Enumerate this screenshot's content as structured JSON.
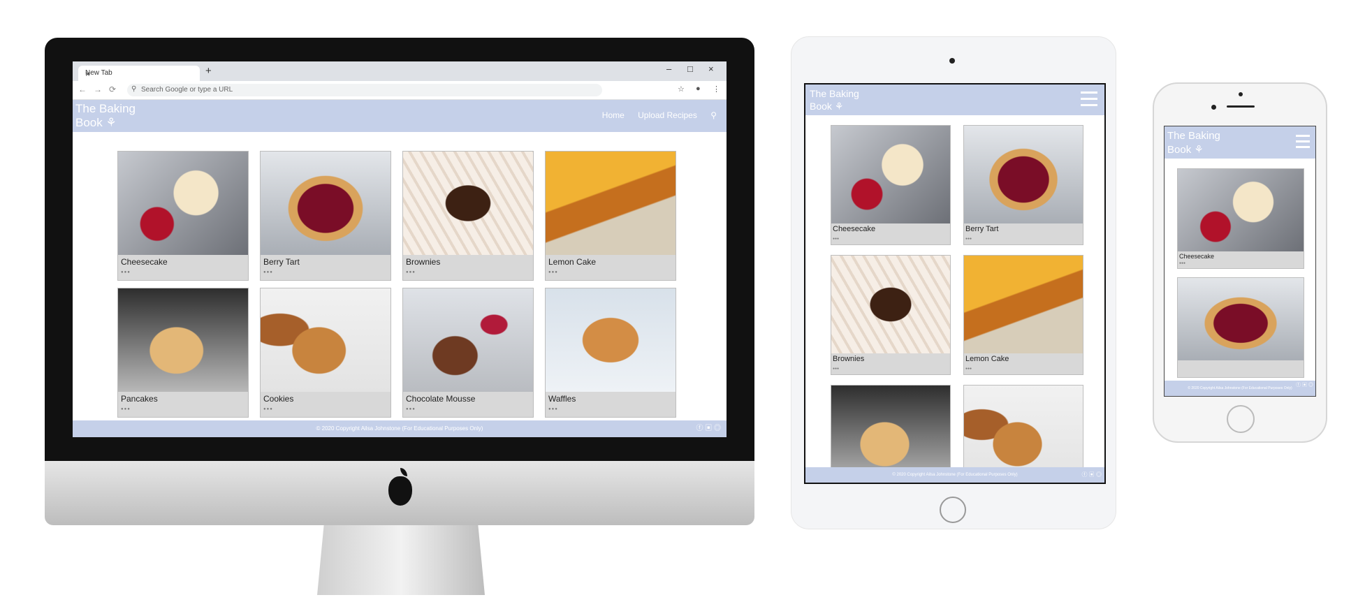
{
  "browser": {
    "tab_title": "New Tab",
    "tab_close": "×",
    "new_tab": "+",
    "minimize": "–",
    "maximize": "□",
    "close": "×",
    "address_placeholder": "Search Google or type a URL"
  },
  "site": {
    "logo_line1": "The Baking",
    "logo_line2": "Book",
    "nav": [
      "Home",
      "Upload Recipes"
    ],
    "footer": "© 2020 Copyright Ailsa Johnstone (For Educational Purposes Only)",
    "footer_icons": "ⓕ ▣ ◎",
    "dots": "●●●"
  },
  "recipes": [
    {
      "name": "Cheesecake",
      "image": "cheesecake"
    },
    {
      "name": "Berry Tart",
      "image": "berry-tart"
    },
    {
      "name": "Brownies",
      "image": "brownies"
    },
    {
      "name": "Lemon Cake",
      "image": "lemon-cake"
    },
    {
      "name": "Pancakes",
      "image": "pancakes"
    },
    {
      "name": "Cookies",
      "image": "cookies"
    },
    {
      "name": "Chocolate Mousse",
      "image": "chocolate-mousse"
    },
    {
      "name": "Waffles",
      "image": "waffles"
    }
  ],
  "colors": {
    "header": "#c5d0e9",
    "card": "#d8d8d8"
  }
}
